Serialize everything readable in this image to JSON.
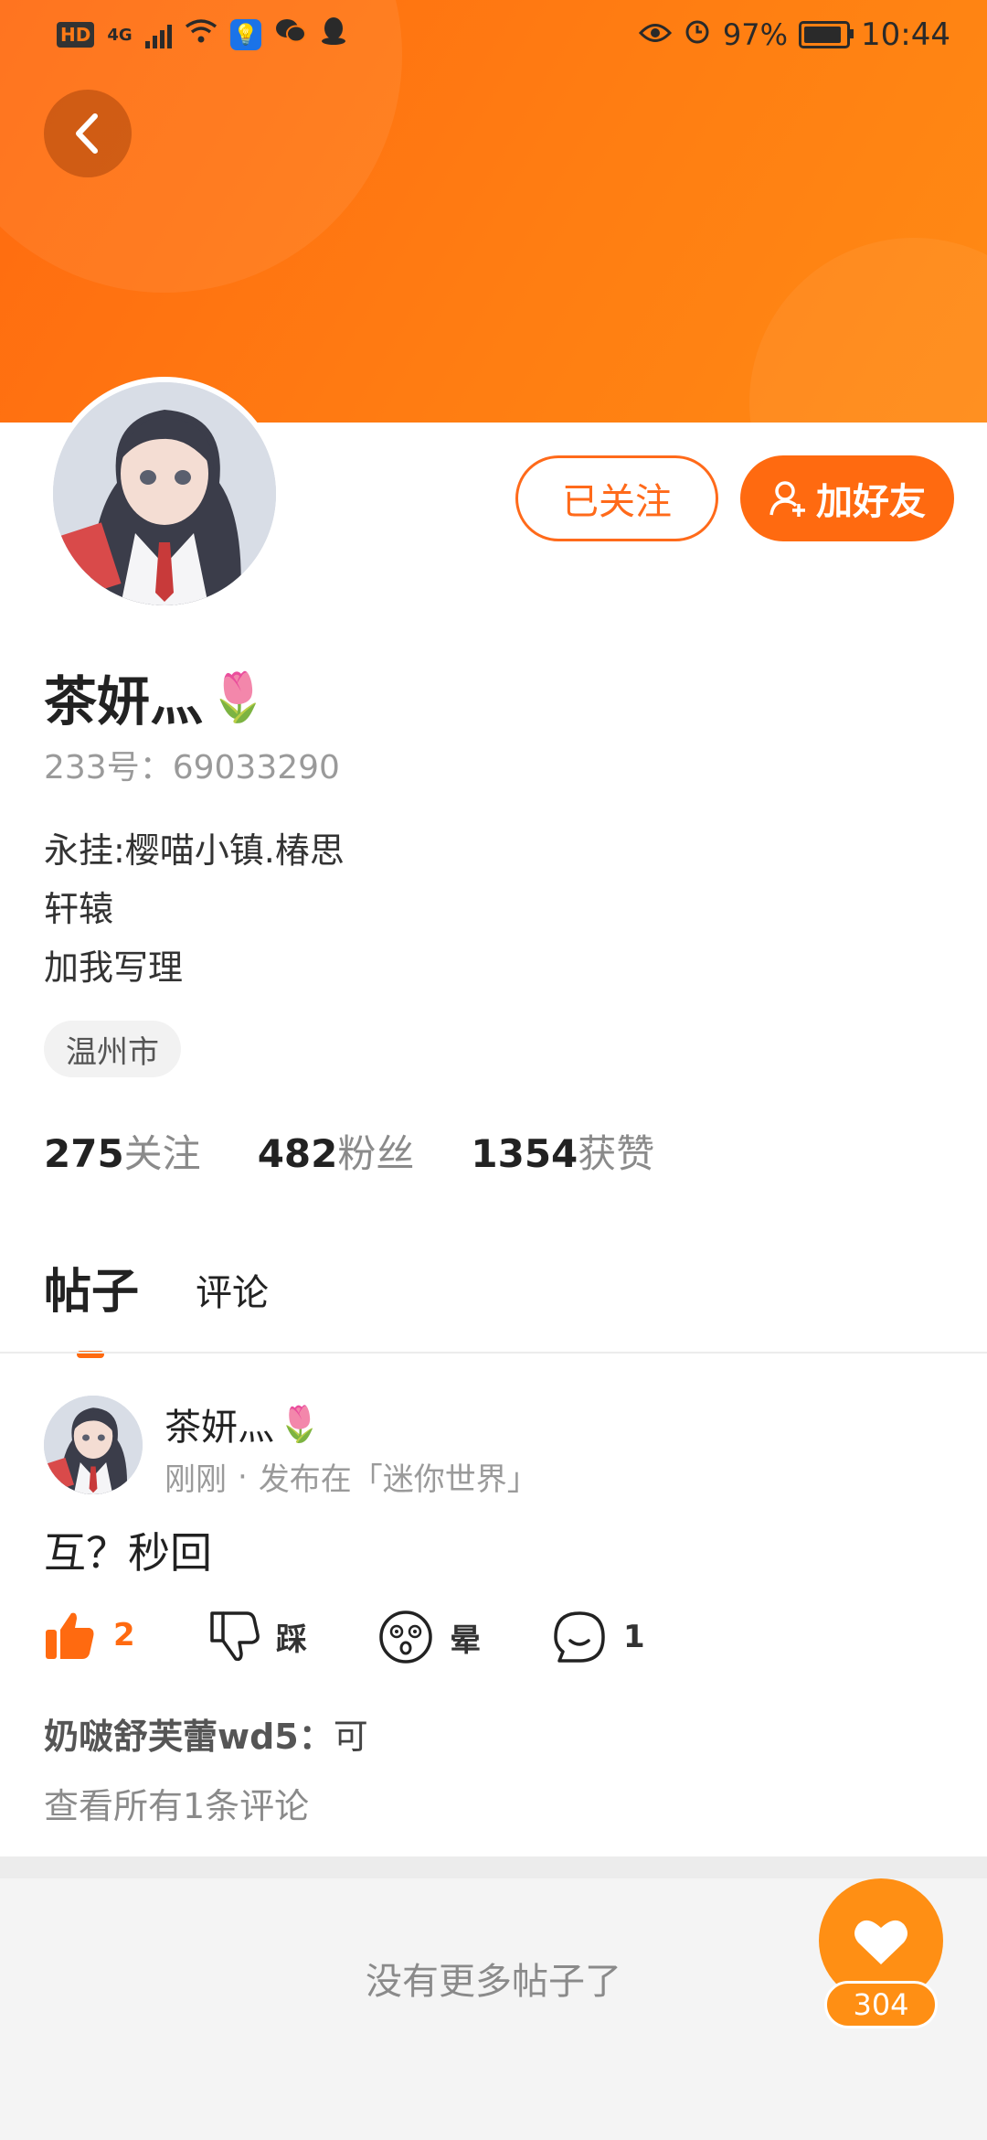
{
  "status_bar": {
    "hd": "HD",
    "network": "4G",
    "battery": "97%",
    "time": "10:44",
    "icons": [
      "signal-icon",
      "wifi-icon",
      "bulb-icon",
      "wechat-icon",
      "qq-icon",
      "eye-icon",
      "alarm-icon",
      "battery-icon"
    ]
  },
  "profile": {
    "name": "茶妍灬",
    "name_emoji": "🌷",
    "id_line": "233号：69033290",
    "bio": [
      "永挂:樱喵小镇.椿思",
      "轩辕",
      "加我写理"
    ],
    "location": "温州市",
    "follow_button": "已关注",
    "add_friend_button": "加好友"
  },
  "stats": [
    {
      "num": "275",
      "label": "关注"
    },
    {
      "num": "482",
      "label": "粉丝"
    },
    {
      "num": "1354",
      "label": "获赞"
    }
  ],
  "tabs": [
    {
      "label": "帖子",
      "active": true
    },
    {
      "label": "评论",
      "active": false
    }
  ],
  "post": {
    "author": "茶妍灬",
    "author_emoji": "🌷",
    "time": "刚刚",
    "dot": "·",
    "published_in": "发布在「迷你世界」",
    "content": "互？秒回",
    "actions": {
      "like_count": "2",
      "dislike_label": "踩",
      "dizzy_label": "晕",
      "comment_count": "1"
    },
    "top_comment_user": "奶啵舒芙蕾wd5：",
    "top_comment_text": "可",
    "view_all": "查看所有1条评论"
  },
  "footer": {
    "no_more": "没有更多帖子了"
  },
  "fab": {
    "count": "304"
  },
  "colors": {
    "accent": "#ff6a10",
    "header_orange": "#ff7d12",
    "fab_orange": "#ff8f14"
  }
}
